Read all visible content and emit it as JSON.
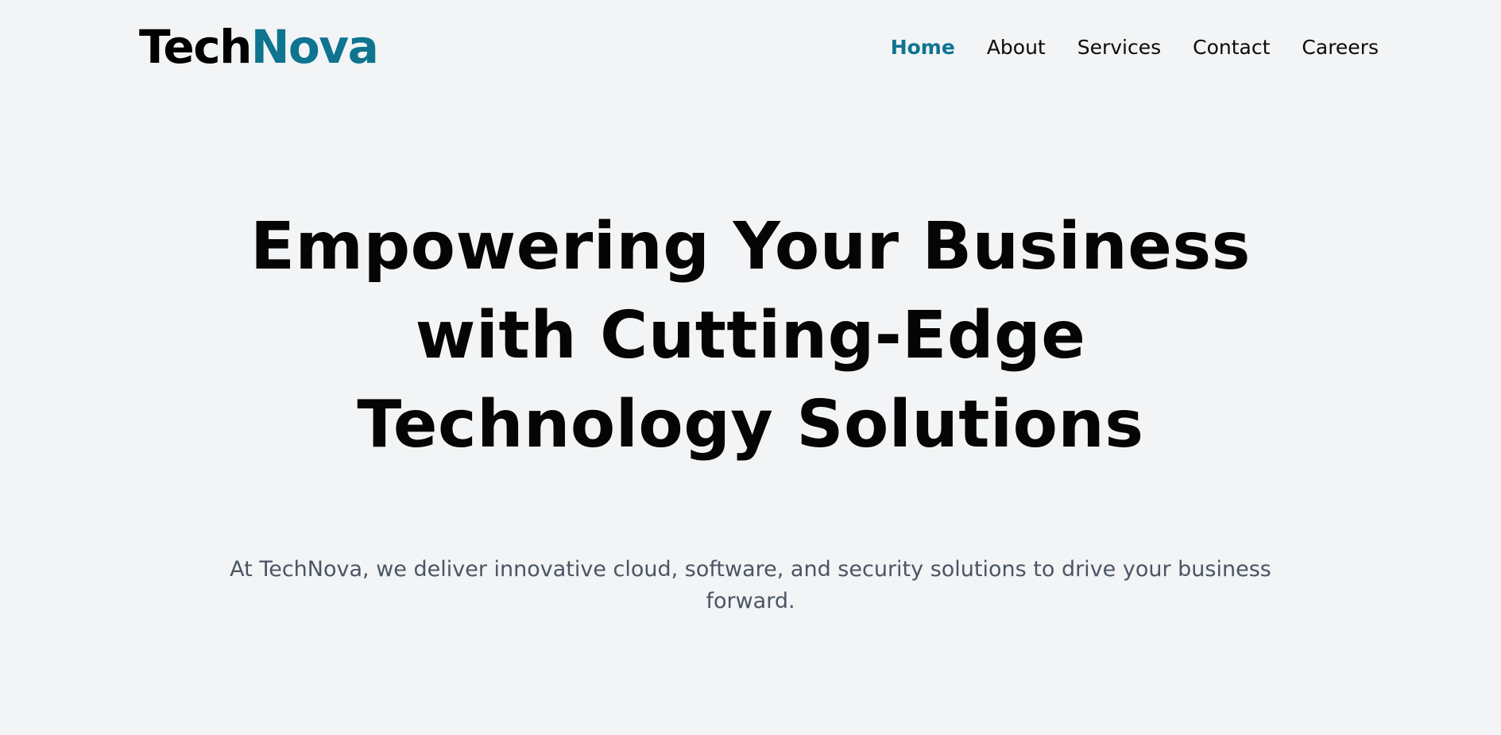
{
  "brand": {
    "name_part1": "Tech",
    "name_part2": "Nova",
    "accent_color": "#0e7490"
  },
  "nav": {
    "items": [
      {
        "label": "Home",
        "active": true
      },
      {
        "label": "About",
        "active": false
      },
      {
        "label": "Services",
        "active": false
      },
      {
        "label": "Contact",
        "active": false
      },
      {
        "label": "Careers",
        "active": false
      }
    ]
  },
  "hero": {
    "title_lines": [
      "Empowering Your Business",
      "with Cutting-Edge",
      "Technology Solutions"
    ],
    "subtitle_lines": [
      "At TechNova, we deliver innovative cloud, software, and security solutions to drive your business",
      "forward."
    ]
  },
  "colors": {
    "background": "#f2f4f6",
    "text": "#000000",
    "subtitle": "#4b5563"
  }
}
